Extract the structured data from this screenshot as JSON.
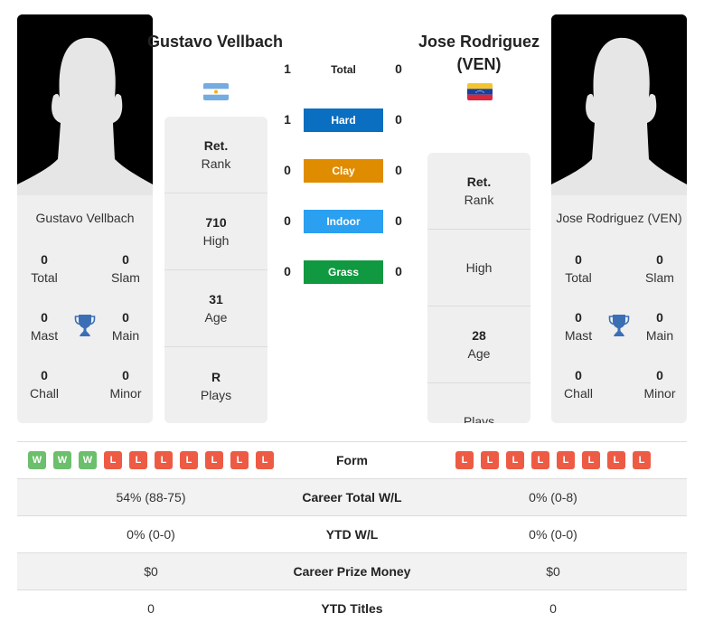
{
  "player1": {
    "name": "Gustavo Vellbach",
    "full_name": "Gustavo Vellbach",
    "country": "Argentina",
    "flag_icon": "argentina-flag-icon",
    "titles": {
      "total": {
        "value": "0",
        "label": "Total"
      },
      "slam": {
        "value": "0",
        "label": "Slam"
      },
      "mast": {
        "value": "0",
        "label": "Mast"
      },
      "main": {
        "value": "0",
        "label": "Main"
      },
      "chall": {
        "value": "0",
        "label": "Chall"
      },
      "minor": {
        "value": "0",
        "label": "Minor"
      }
    },
    "rank_card": [
      {
        "value": "Ret.",
        "label": "Rank"
      },
      {
        "value": "710",
        "label": "High"
      },
      {
        "value": "31",
        "label": "Age"
      },
      {
        "value": "R",
        "label": "Plays"
      }
    ]
  },
  "player2": {
    "name": "Jose Rodriguez (VEN)",
    "full_name": "Jose Rodriguez (VEN)",
    "country": "Venezuela",
    "flag_icon": "venezuela-flag-icon",
    "titles": {
      "total": {
        "value": "0",
        "label": "Total"
      },
      "slam": {
        "value": "0",
        "label": "Slam"
      },
      "mast": {
        "value": "0",
        "label": "Mast"
      },
      "main": {
        "value": "0",
        "label": "Main"
      },
      "chall": {
        "value": "0",
        "label": "Chall"
      },
      "minor": {
        "value": "0",
        "label": "Minor"
      }
    },
    "rank_card": [
      {
        "value": "Ret.",
        "label": "Rank"
      },
      {
        "value": "",
        "label": "High"
      },
      {
        "value": "28",
        "label": "Age"
      },
      {
        "value": "",
        "label": "Plays"
      }
    ]
  },
  "h2h": [
    {
      "surface": "Total",
      "p1": "1",
      "p2": "0",
      "color": ""
    },
    {
      "surface": "Hard",
      "p1": "1",
      "p2": "0",
      "color": "#0a6ec1"
    },
    {
      "surface": "Clay",
      "p1": "0",
      "p2": "0",
      "color": "#e08c00"
    },
    {
      "surface": "Indoor",
      "p1": "0",
      "p2": "0",
      "color": "#2b9ff0"
    },
    {
      "surface": "Grass",
      "p1": "0",
      "p2": "0",
      "color": "#109940"
    }
  ],
  "comparison": {
    "form": {
      "label": "Form",
      "p1": [
        "W",
        "W",
        "W",
        "L",
        "L",
        "L",
        "L",
        "L",
        "L",
        "L"
      ],
      "p2": [
        "L",
        "L",
        "L",
        "L",
        "L",
        "L",
        "L",
        "L"
      ]
    },
    "rows": [
      {
        "label": "Career Total W/L",
        "p1": "54% (88-75)",
        "p2": "0% (0-8)"
      },
      {
        "label": "YTD W/L",
        "p1": "0% (0-0)",
        "p2": "0% (0-0)"
      },
      {
        "label": "Career Prize Money",
        "p1": "$0",
        "p2": "$0"
      },
      {
        "label": "YTD Titles",
        "p1": "0",
        "p2": "0"
      }
    ]
  },
  "colors": {
    "win": "#6cbf6c",
    "loss": "#ee5b44",
    "trophy": "#3a6fb5"
  }
}
